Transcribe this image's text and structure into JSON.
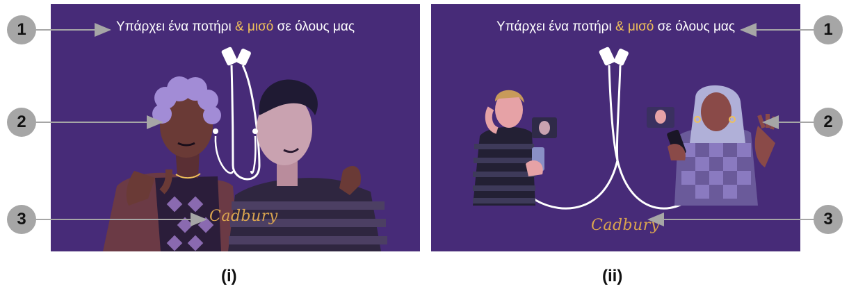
{
  "panels": [
    {
      "tagline_before": "Υπάρχει ένα ποτήρι ",
      "tagline_accent": "& μισό",
      "tagline_after": " σε όλους μας",
      "brand": "Cadbury",
      "caption": "(i)"
    },
    {
      "tagline_before": "Υπάρχει ένα ποτήρι ",
      "tagline_accent": "& μισό",
      "tagline_after": " σε όλους μας",
      "brand": "Cadbury",
      "caption": "(ii)"
    }
  ],
  "callouts": {
    "one": "1",
    "two": "2",
    "three": "3"
  },
  "colors": {
    "background": "#472b78",
    "accent_text": "#f0c05a",
    "brand_gold": "#d9a44f",
    "badge": "#a6a6a6",
    "arrow": "#a6a6a6"
  }
}
